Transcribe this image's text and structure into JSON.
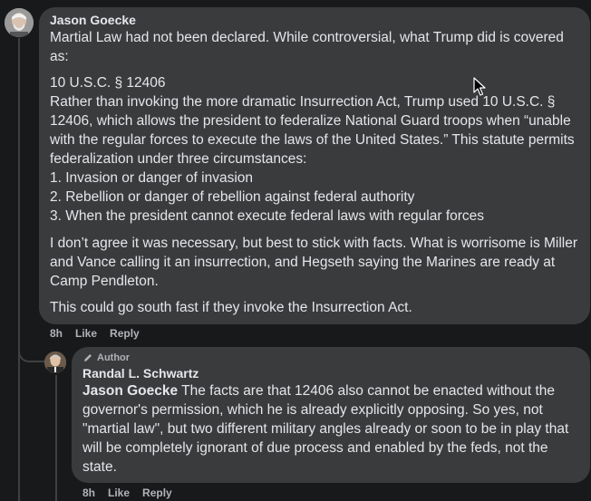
{
  "comment1": {
    "author": "Jason Goecke",
    "lines": [
      "Martial Law had not been declared. While controversial, what Trump did is covered as:",
      "10 U.S.C. § 12406",
      "Rather than invoking the more dramatic Insurrection Act, Trump used 10 U.S.C. § 12406, which allows the president to federalize National Guard troops when “unable with the regular forces to execute the laws of the United States.” This statute permits federalization under three circumstances:",
      "1. Invasion or danger of invasion",
      "2. Rebellion or danger of rebellion against federal authority",
      "3. When the president cannot execute federal laws with regular forces",
      "I don’t agree it was necessary, but best to stick with facts. What is worrisome is Miller and Vance calling it an insurrection, and Hegseth saying the Marines are ready at Camp Pendleton.",
      "This could go south fast if they invoke the Insurrection Act."
    ],
    "time": "8h",
    "like": "Like",
    "reply": "Reply"
  },
  "comment2": {
    "badge": "Author",
    "badge_icon": "pencil-icon",
    "author": "Randal L. Schwartz",
    "mention": "Jason Goecke",
    "text": " The facts are that 12406 also cannot be enacted without the governor's permission, which he is already explicitly opposing. So yes, not \"martial law\", but two different military angles already or soon to be in play that will be completely ignorant of due process and enabled by the feds, not the state.",
    "time": "8h",
    "like": "Like",
    "reply": "Reply"
  },
  "colors": {
    "background": "#18191a",
    "bubble": "#3a3b3c",
    "text": "#e4e6eb",
    "secondary": "#b0b3b8"
  }
}
